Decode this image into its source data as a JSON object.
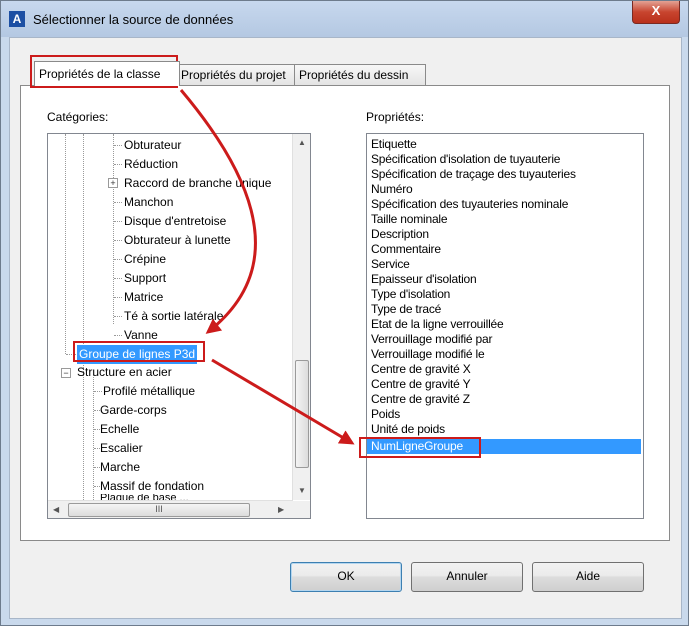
{
  "window": {
    "title": "Sélectionner la source de données",
    "close_label": "X"
  },
  "tabs": [
    {
      "label": "Propriétés de la classe"
    },
    {
      "label": "Propriétés du projet"
    },
    {
      "label": "Propriétés du dessin"
    }
  ],
  "categories": {
    "label": "Catégories:",
    "items": [
      "Obturateur",
      "Réduction",
      "Raccord de branche unique",
      "Manchon",
      "Disque d'entretoise",
      "Obturateur à lunette",
      "Crépine",
      "Support",
      "Matrice",
      "Té à sortie latérale",
      "Vanne",
      "Groupe de lignes P3d",
      "Structure en acier",
      "Profilé métallique",
      "Garde-corps",
      "Echelle",
      "Escalier",
      "Marche",
      "Massif de fondation",
      "Plaque de base ..."
    ],
    "selected": "Groupe de lignes P3d",
    "hscroll_thumb": "III"
  },
  "properties": {
    "label": "Propriétés:",
    "items": [
      "Etiquette",
      "Spécification d'isolation de tuyauterie",
      "Spécification de traçage des tuyauteries",
      "Numéro",
      "Spécification des tuyauteries nominale",
      "Taille nominale",
      "Description",
      "Commentaire",
      "Service",
      "Epaisseur d'isolation",
      "Type d'isolation",
      "Type de tracé",
      "Etat de la ligne verrouillée",
      "Verrouillage modifié par",
      "Verrouillage modifié le",
      "Centre de gravité X",
      "Centre de gravité Y",
      "Centre de gravité Z",
      "Poids",
      "Unité de poids",
      "NumLigneGroupe"
    ],
    "selected": "NumLigneGroupe"
  },
  "buttons": {
    "ok": "OK",
    "cancel": "Annuler",
    "help": "Aide"
  },
  "colors": {
    "selection": "#3399ff",
    "highlight": "#cc1b1b",
    "arrow": "#cc1b1b"
  }
}
